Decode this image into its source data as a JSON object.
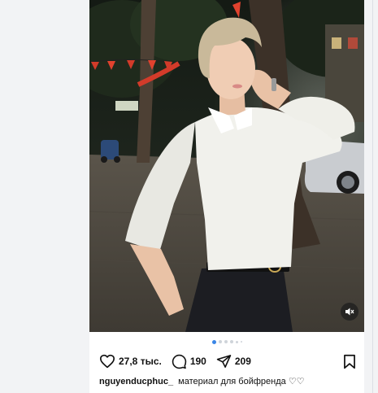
{
  "post": {
    "media": {
      "mute_icon": "speaker-muted-icon",
      "carousel_total": 6,
      "carousel_current": 1
    },
    "actions": {
      "likes": "27,8 тыс.",
      "comments": "190",
      "shares": "209",
      "like_icon": "heart-icon",
      "comment_icon": "comment-bubble-icon",
      "share_icon": "send-icon",
      "save_icon": "bookmark-icon"
    },
    "caption": {
      "username": "nguyenducphuc_",
      "text": "материал для бойфренда ♡♡"
    }
  },
  "colors": {
    "accent": "#3a86e6",
    "page_bg": "#f3f4f6",
    "text": "#111111"
  }
}
